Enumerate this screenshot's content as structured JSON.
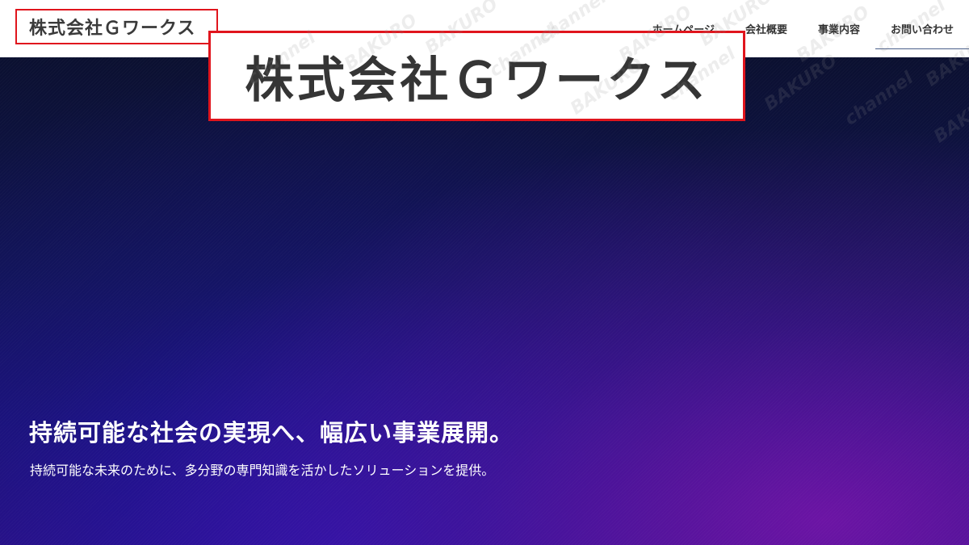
{
  "header": {
    "logo": "株式会社Ｇワークス",
    "nav": [
      {
        "label": "ホームページ"
      },
      {
        "label": "会社概要"
      },
      {
        "label": "事業内容"
      },
      {
        "label": "お問い合わせ"
      }
    ]
  },
  "zoom": {
    "text": "株式会社Ｇワークス"
  },
  "hero": {
    "title": "持続可能な社会の実現へ、幅広い事業展開。",
    "subtitle": "持続可能な未来のために、多分野の専門知識を活かしたソリューションを提供。"
  },
  "watermark": {
    "words": [
      "BAKURO",
      "channel"
    ]
  },
  "colors": {
    "accent": "#e0151d",
    "hero_top": "#0b1030",
    "hero_bottom": "#2a1085"
  }
}
